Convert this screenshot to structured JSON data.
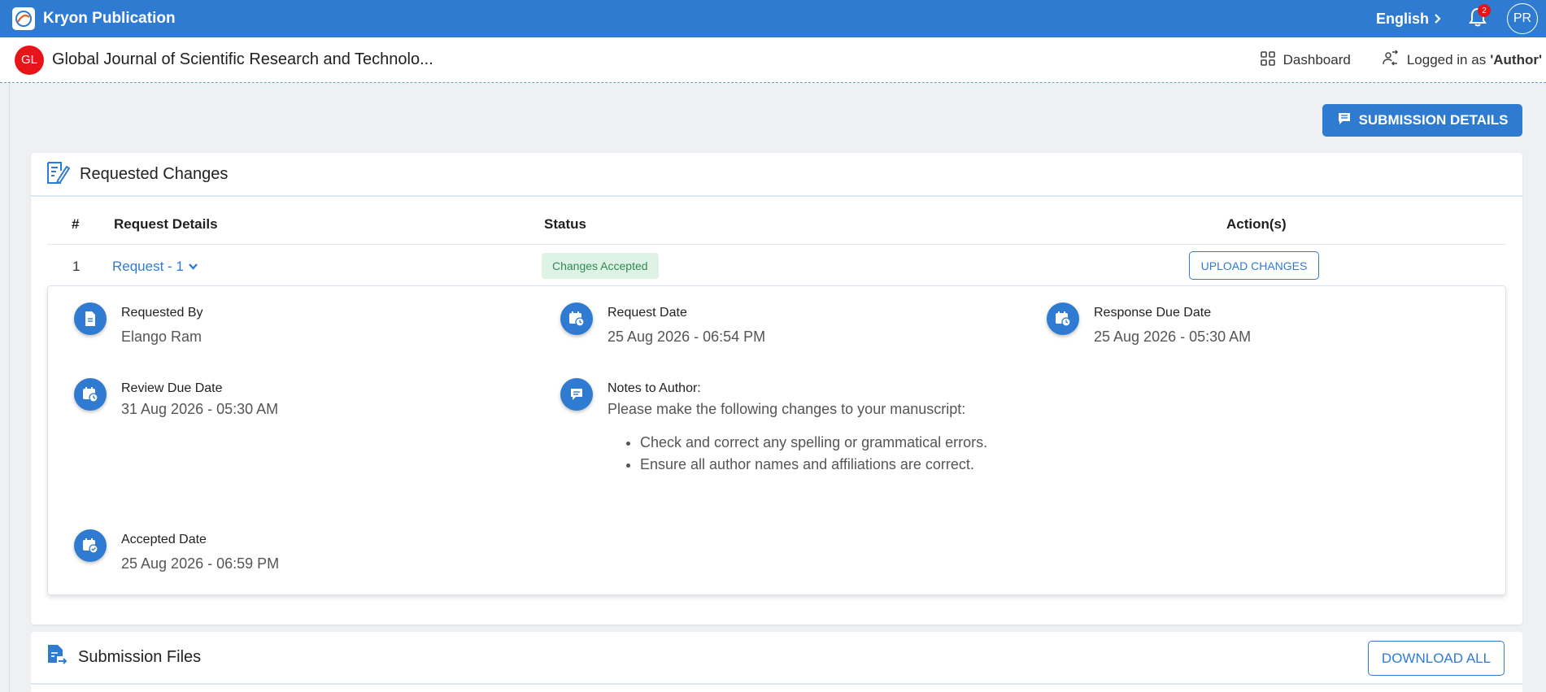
{
  "app": {
    "title": "Kryon Publication"
  },
  "topbar": {
    "language": "English",
    "notification_count": "2",
    "user_initials": "PR"
  },
  "journal": {
    "badge": "GL",
    "title": "Global Journal of Scientific Research and Technolo..."
  },
  "nav": {
    "dashboard_label": "Dashboard",
    "logged_in_prefix": "Logged in as",
    "logged_in_role": "'Author'"
  },
  "actions": {
    "submission_details_label": "SUBMISSION DETAILS"
  },
  "requested_changes": {
    "title": "Requested Changes",
    "columns": {
      "num": "#",
      "details": "Request Details",
      "status": "Status",
      "actions": "Action(s)"
    },
    "row": {
      "num": "1",
      "request_label": "Request - 1",
      "status": "Changes Accepted",
      "action_label": "UPLOAD CHANGES",
      "details": {
        "requested_by": {
          "label": "Requested By",
          "value": "Elango Ram"
        },
        "request_date": {
          "label": "Request Date",
          "value": "25 Aug 2026 - 06:54 PM"
        },
        "response_due_date": {
          "label": "Response Due Date",
          "value": "25 Aug 2026 - 05:30 AM"
        },
        "review_due_date": {
          "label": "Review Due Date",
          "value": "31 Aug 2026 - 05:30 AM"
        },
        "notes": {
          "label": "Notes to Author:",
          "intro": "Please make the following changes to your manuscript:",
          "items": [
            "Check and correct any spelling or grammatical errors.",
            "Ensure all author names and affiliations are correct."
          ]
        },
        "accepted_date": {
          "label": "Accepted Date",
          "value": "25 Aug 2026 - 06:59 PM"
        }
      }
    }
  },
  "submission_files": {
    "title": "Submission Files",
    "download_all_label": "DOWNLOAD ALL"
  },
  "colors": {
    "primary": "#2f7bd1",
    "badge_red": "#e8141a",
    "success_bg": "#dff2e6",
    "success_text": "#2f8a55"
  },
  "icons": [
    "app-logo-icon",
    "chevron-right-icon",
    "bell-icon",
    "dashboard-grid-icon",
    "user-switch-icon",
    "document-list-icon",
    "edit-document-icon",
    "chevron-down-icon",
    "document-icon",
    "calendar-clock-icon",
    "chat-bubble-icon",
    "calendar-check-icon",
    "file-export-icon"
  ]
}
